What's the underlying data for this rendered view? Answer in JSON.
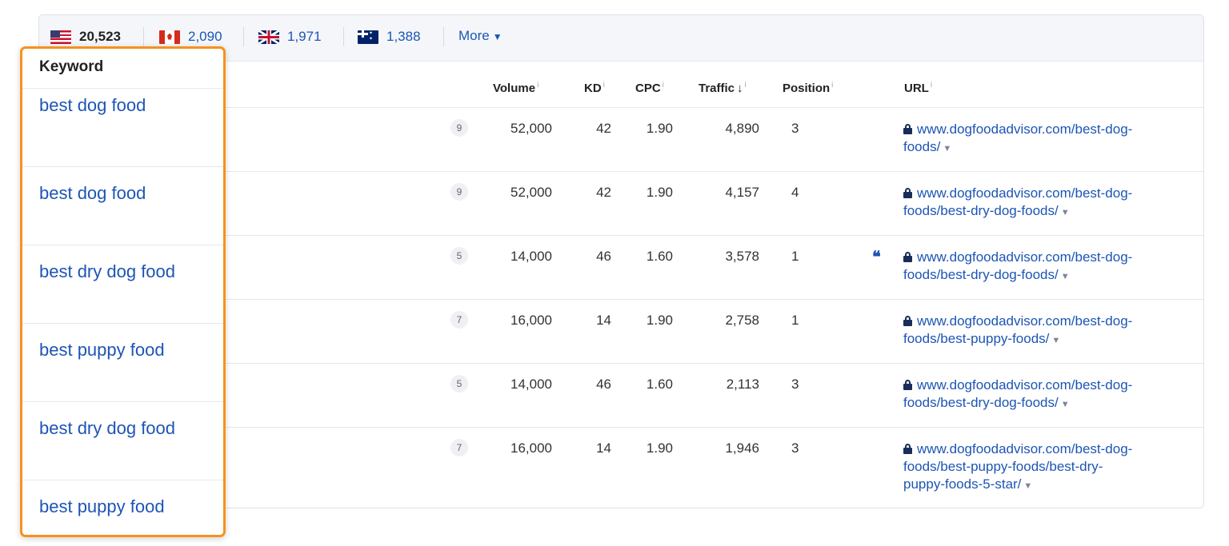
{
  "countries": [
    {
      "flag": "us-flag-icon",
      "count": "20,523",
      "active": true
    },
    {
      "flag": "ca-flag-icon",
      "count": "2,090",
      "active": false
    },
    {
      "flag": "uk-flag-icon",
      "count": "1,971",
      "active": false
    },
    {
      "flag": "au-flag-icon",
      "count": "1,388",
      "active": false
    }
  ],
  "more_label": "More",
  "columns": {
    "keyword": "Keyword",
    "volume": "Volume",
    "kd": "KD",
    "cpc": "CPC",
    "traffic": "Traffic",
    "position": "Position",
    "url": "URL",
    "info": "i"
  },
  "rows": [
    {
      "keyword": "best dog food",
      "serp": "9",
      "volume": "52,000",
      "kd": "42",
      "cpc": "1.90",
      "traffic": "4,890",
      "position": "3",
      "featured": false,
      "url_lines": [
        "www.dogfoodadvisor.com/best-dog-",
        "foods/"
      ]
    },
    {
      "keyword": "best dog food",
      "serp": "9",
      "volume": "52,000",
      "kd": "42",
      "cpc": "1.90",
      "traffic": "4,157",
      "position": "4",
      "featured": false,
      "url_lines": [
        "www.dogfoodadvisor.com/best-dog-",
        "foods/best-dry-dog-foods/"
      ]
    },
    {
      "keyword": "best dry dog food",
      "serp": "5",
      "volume": "14,000",
      "kd": "46",
      "cpc": "1.60",
      "traffic": "3,578",
      "position": "1",
      "featured": true,
      "url_lines": [
        "www.dogfoodadvisor.com/best-dog-",
        "foods/best-dry-dog-foods/"
      ]
    },
    {
      "keyword": "best puppy food",
      "serp": "7",
      "volume": "16,000",
      "kd": "14",
      "cpc": "1.90",
      "traffic": "2,758",
      "position": "1",
      "featured": false,
      "url_lines": [
        "www.dogfoodadvisor.com/best-dog-",
        "foods/best-puppy-foods/"
      ]
    },
    {
      "keyword": "best dry dog food",
      "serp": "5",
      "volume": "14,000",
      "kd": "46",
      "cpc": "1.60",
      "traffic": "2,113",
      "position": "3",
      "featured": false,
      "url_lines": [
        "www.dogfoodadvisor.com/best-dog-",
        "foods/best-dry-dog-foods/"
      ]
    },
    {
      "keyword": "best puppy food",
      "serp": "7",
      "volume": "16,000",
      "kd": "14",
      "cpc": "1.90",
      "traffic": "1,946",
      "position": "3",
      "featured": false,
      "url_lines": [
        "www.dogfoodadvisor.com/best-dog-",
        "foods/best-puppy-foods/best-dry-",
        "puppy-foods-5-star/"
      ]
    }
  ],
  "featured_icon": "quote-icon",
  "colors": {
    "highlight": "#f7911e",
    "link": "#1d55b5"
  }
}
